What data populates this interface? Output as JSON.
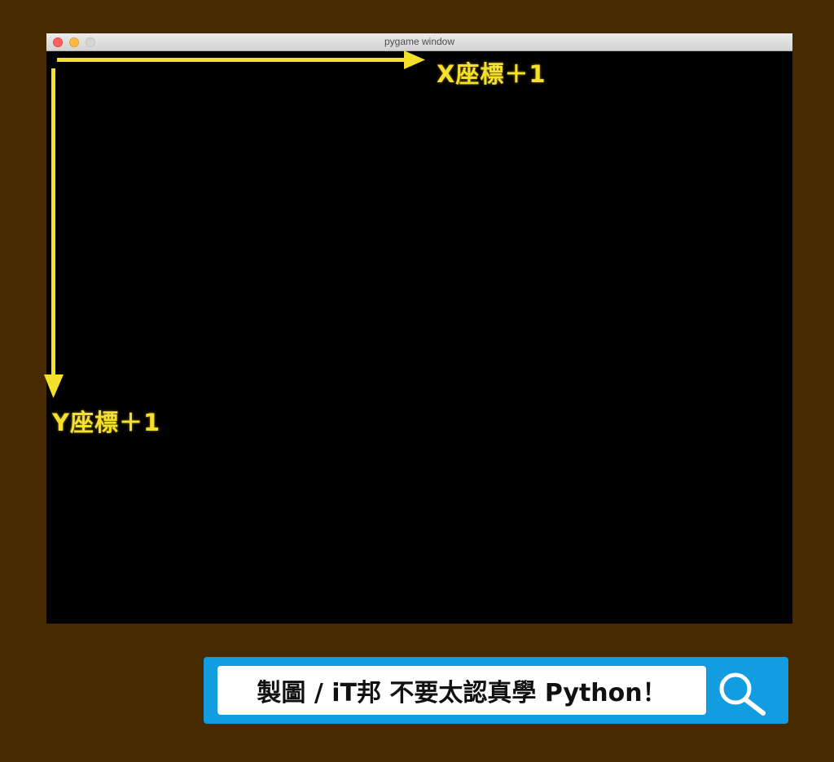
{
  "window": {
    "title": "pygame window"
  },
  "canvas": {
    "x_axis_label": "X座標＋1",
    "y_axis_label": "Y座標＋1",
    "arrow_color": "#f3df2c",
    "background_color": "#000000"
  },
  "search": {
    "text": "製圖 / iT邦 不要太認真學 Python！",
    "bar_color": "#119de0"
  },
  "icons": {
    "search": "search-icon"
  },
  "page": {
    "background_color": "#472a00"
  }
}
